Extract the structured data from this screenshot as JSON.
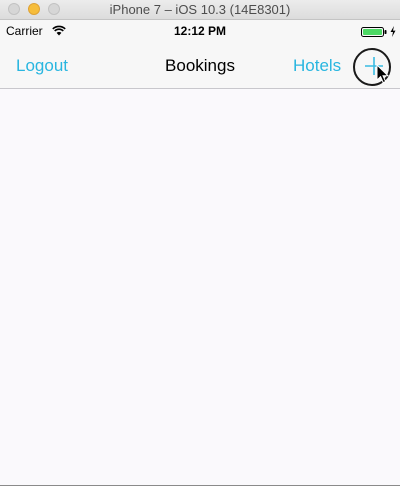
{
  "window": {
    "title": "iPhone 7 – iOS 10.3 (14E8301)"
  },
  "status_bar": {
    "carrier": "Carrier",
    "time": "12:12 PM",
    "wifi_icon": "wifi-icon",
    "battery_icon": "battery-charging-icon",
    "battery_color": "#4cd964"
  },
  "nav_bar": {
    "left_button": "Logout",
    "title": "Bookings",
    "right_button": "Hotels",
    "add_icon": "plus-icon",
    "tint_color": "#29b6e0"
  },
  "content": {
    "background": "#faf9fc"
  }
}
